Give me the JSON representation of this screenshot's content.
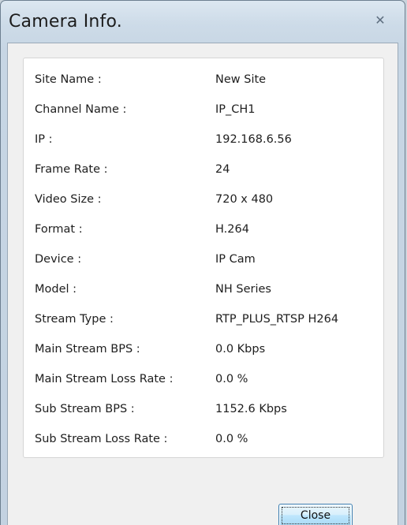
{
  "window": {
    "title": "Camera Info.",
    "close_glyph": "✕"
  },
  "info_rows": [
    {
      "label": "Site Name :",
      "value": "New Site"
    },
    {
      "label": "Channel Name :",
      "value": "IP_CH1"
    },
    {
      "label": "IP :",
      "value": "192.168.6.56"
    },
    {
      "label": "Frame Rate :",
      "value": "24"
    },
    {
      "label": "Video Size :",
      "value": "720 x 480"
    },
    {
      "label": "Format :",
      "value": "H.264"
    },
    {
      "label": "Device :",
      "value": "IP Cam"
    },
    {
      "label": "Model :",
      "value": "NH Series"
    },
    {
      "label": "Stream Type :",
      "value": "RTP_PLUS_RTSP H264"
    },
    {
      "label": "Main Stream BPS :",
      "value": "0.0 Kbps"
    },
    {
      "label": "Main Stream Loss Rate :",
      "value": "0.0 %"
    },
    {
      "label": "Sub Stream BPS :",
      "value": "1152.6 Kbps"
    },
    {
      "label": "Sub Stream Loss Rate :",
      "value": "0.0 %"
    }
  ],
  "buttons": {
    "close_label": "Close"
  }
}
